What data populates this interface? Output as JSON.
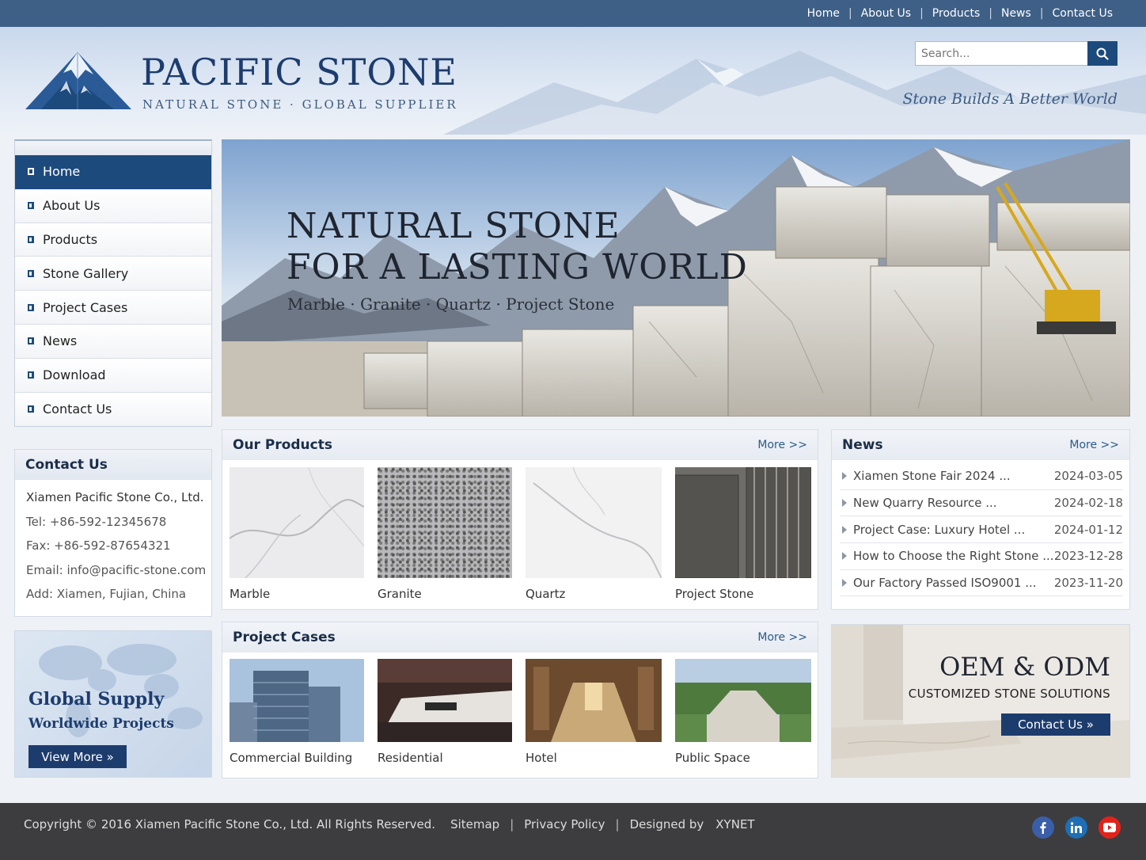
{
  "topnav": {
    "links": [
      "Home",
      "About Us",
      "Products",
      "News",
      "Contact Us"
    ],
    "separator": "|"
  },
  "header": {
    "brand_name": "PACIFIC STONE",
    "brand_tagline": "NATURAL STONE · GLOBAL SUPPLIER",
    "search_placeholder": "Search...",
    "slogan": "Stone Builds A Better World",
    "search_icon": "search-icon"
  },
  "sidebar": {
    "items": [
      {
        "label": "Home",
        "active": true
      },
      {
        "label": "About Us"
      },
      {
        "label": "Products"
      },
      {
        "label": "Stone Gallery"
      },
      {
        "label": "Project Cases"
      },
      {
        "label": "News"
      },
      {
        "label": "Download"
      },
      {
        "label": "Contact Us"
      }
    ]
  },
  "contact": {
    "title": "Contact Us",
    "company": "Xiamen Pacific Stone Co., Ltd.",
    "tel": "Tel: +86-592-12345678",
    "fax": "Fax: +86-592-87654321",
    "email": "Email: info@pacific-stone.com",
    "address": "Add: Xiamen, Fujian, China"
  },
  "global": {
    "title": "Global Supply",
    "subtitle": "Worldwide Projects",
    "button": "View More »"
  },
  "banner": {
    "line1": "NATURAL STONE",
    "line2": "FOR A LASTING WORLD",
    "subtitle": "Marble · Granite · Quartz · Project Stone"
  },
  "products": {
    "title": "Our Products",
    "more": "More >>",
    "items": [
      "Marble",
      "Granite",
      "Quartz",
      "Project Stone"
    ]
  },
  "projects": {
    "title": "Project Cases",
    "more": "More >>",
    "items": [
      "Commercial Building",
      "Residential",
      "Hotel",
      "Public Space"
    ]
  },
  "news": {
    "title": "News",
    "more": "More >>",
    "items": [
      {
        "title": "Xiamen Stone Fair 2024 ...",
        "date": "2024-03-05"
      },
      {
        "title": "New Quarry Resource ...",
        "date": "2024-02-18"
      },
      {
        "title": "Project Case: Luxury Hotel ...",
        "date": "2024-01-12"
      },
      {
        "title": "How to Choose the Right Stone ...",
        "date": "2023-12-28"
      },
      {
        "title": "Our Factory Passed ISO9001 ...",
        "date": "2023-11-20"
      }
    ]
  },
  "oem": {
    "title": "OEM & ODM",
    "subtitle": "CUSTOMIZED STONE SOLUTIONS",
    "button": "Contact Us »"
  },
  "footer": {
    "copyright": "Copyright © 2016 Xiamen Pacific Stone Co., Ltd. All Rights Reserved.",
    "sitemap": "Sitemap",
    "privacy": "Privacy Policy",
    "designed_by": "Designed by",
    "designer": "XYNET",
    "separator": "|",
    "social": [
      "facebook-icon",
      "linkedin-icon",
      "youtube-icon"
    ]
  },
  "colors": {
    "primary": "#1d4a7c",
    "topbar": "#3e5f86",
    "footer": "#3d3d3f"
  }
}
